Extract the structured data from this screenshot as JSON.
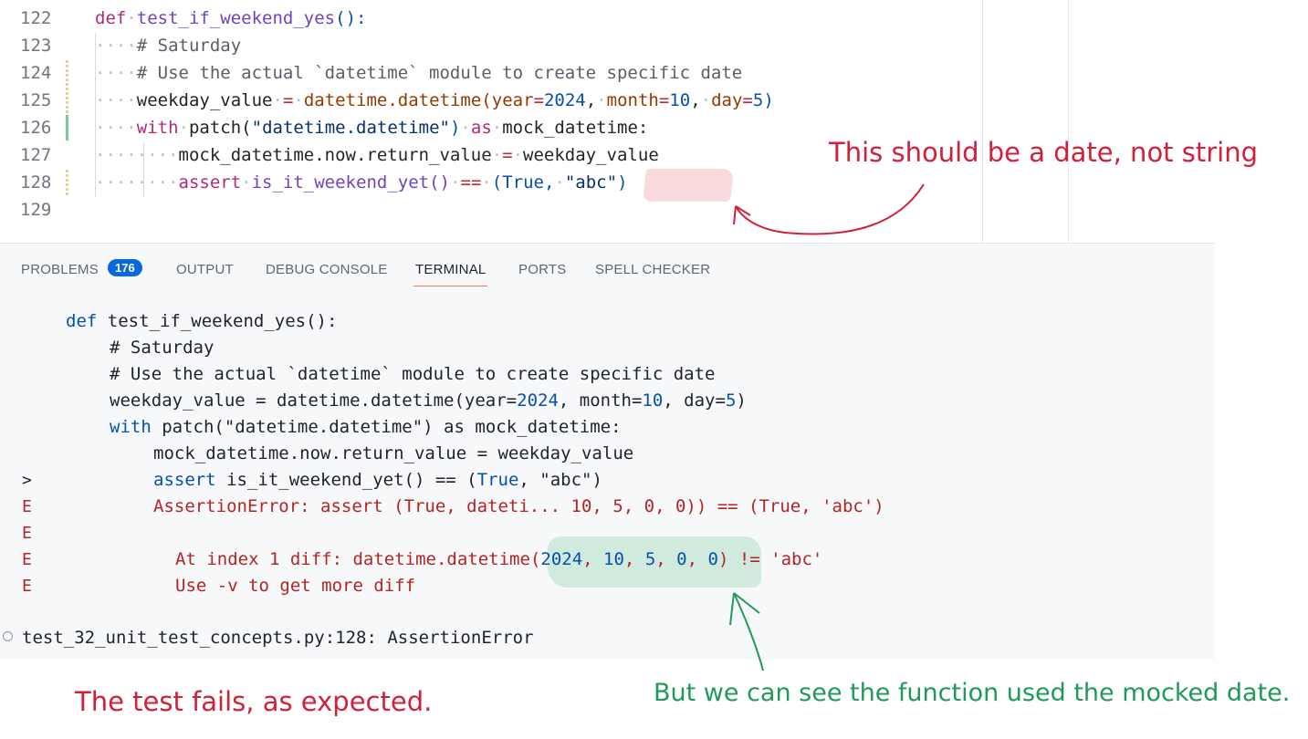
{
  "editor": {
    "line_numbers": [
      "122",
      "123",
      "124",
      "125",
      "126",
      "127",
      "128",
      "129"
    ],
    "code": {
      "l122": {
        "kw": "def",
        "fn": "test_if_weekend_yes",
        "tail": "():"
      },
      "l123": {
        "comment": "# Saturday"
      },
      "l124": {
        "comment": "# Use the actual `datetime` module to create specific date"
      },
      "l125": {
        "var": "weekday_value",
        "eq": "=",
        "call": "datetime.datetime(",
        "p1": "year",
        "v1": "2024",
        "p2": "month",
        "v2": "10",
        "p3": "day",
        "v3": "5",
        "close": ")"
      },
      "l126": {
        "kw": "with",
        "call": "patch(",
        "str": "\"datetime.datetime\"",
        "close": ")",
        "as": "as",
        "name": "mock_datetime:"
      },
      "l127": {
        "text": "mock_datetime.now.return_value",
        "eq": "=",
        "val": "weekday_value"
      },
      "l128": {
        "kw": "assert",
        "fn": "is_it_weekend_yet()",
        "op": "==",
        "open": "(",
        "bool": "True,",
        "str": "\"abc\"",
        "close": ")"
      }
    }
  },
  "panel": {
    "tabs": [
      {
        "label": "PROBLEMS",
        "active": false
      },
      {
        "label": "OUTPUT",
        "active": false
      },
      {
        "label": "DEBUG CONSOLE",
        "active": false
      },
      {
        "label": "TERMINAL",
        "active": true
      },
      {
        "label": "PORTS",
        "active": false
      },
      {
        "label": "SPELL CHECKER",
        "active": false
      }
    ],
    "problems_count": "176",
    "terminal": {
      "l1": {
        "kw": "def",
        "rest": " test_if_weekend_yes():"
      },
      "l2": "# Saturday",
      "l3": "# Use the actual `datetime` module to create specific date",
      "l4": {
        "a": "weekday_value = datetime.datetime(year=",
        "n1": "2024",
        "b": ", month=",
        "n2": "10",
        "c": ", day=",
        "n3": "5",
        "d": ")"
      },
      "l5": {
        "kw": "with",
        "rest": " patch(\"datetime.datetime\") as mock_datetime:"
      },
      "l6": "mock_datetime.now.return_value = weekday_value",
      "l7": {
        "kw": "assert",
        "a": " is_it_weekend_yet() == (",
        "bool": "True",
        "b": ", \"abc\")"
      },
      "l8": "AssertionError: assert (True, dateti... 10, 5, 0, 0)) == (True, 'abc')",
      "l10": {
        "a": "At index 1 diff: datetime.datetime(",
        "n1": "2024",
        "s1": ", ",
        "n2": "10",
        "s2": ", ",
        "n3": "5",
        "s3": ", ",
        "n4": "0",
        "s4": ", ",
        "n5": "0",
        "b": ") != 'abc'"
      },
      "l11": "Use -v to get more diff",
      "marker_gt": ">",
      "marker_e": "E",
      "footer": "test_32_unit_test_concepts.py:128: AssertionError"
    }
  },
  "annotations": {
    "top_note": "This should be a date, not string",
    "bottom_left": "The test fails, as expected.",
    "bottom_right": "But we can see the function used the mocked date.",
    "colors": {
      "red": "#d1203a",
      "green": "#1f9a5a"
    }
  }
}
